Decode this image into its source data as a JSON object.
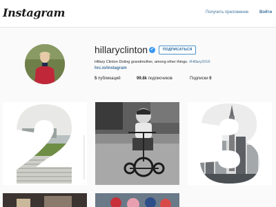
{
  "header": {
    "logo": "Instagram",
    "get_app": "Получить приложение",
    "login": "Войти"
  },
  "profile": {
    "username": "hillaryclinton",
    "verified_glyph": "✔",
    "follow_label": "ПОДПИСАТЬСЯ",
    "bio": "Hillary Clinton Doting grandmother, among other things.",
    "bio_hashtag": "#Hillary2016",
    "link": "hrc.io/instagram",
    "stats": {
      "posts_value": "5",
      "posts_label": "публикаций",
      "followers_value": "99.8k",
      "followers_label": "подписчиков",
      "following_label": "Подписки",
      "following_value": "0"
    }
  },
  "posts": [
    {
      "icon": "number-two-cutout-image"
    },
    {
      "icon": "child-on-tricycle-photo"
    },
    {
      "icon": "number-three-skyline-image"
    },
    {
      "icon": "photo-partial"
    },
    {
      "icon": "photo-partial"
    }
  ],
  "colors": {
    "link": "#3f729b",
    "verified": "#3897f0",
    "background": "#fafafa"
  }
}
